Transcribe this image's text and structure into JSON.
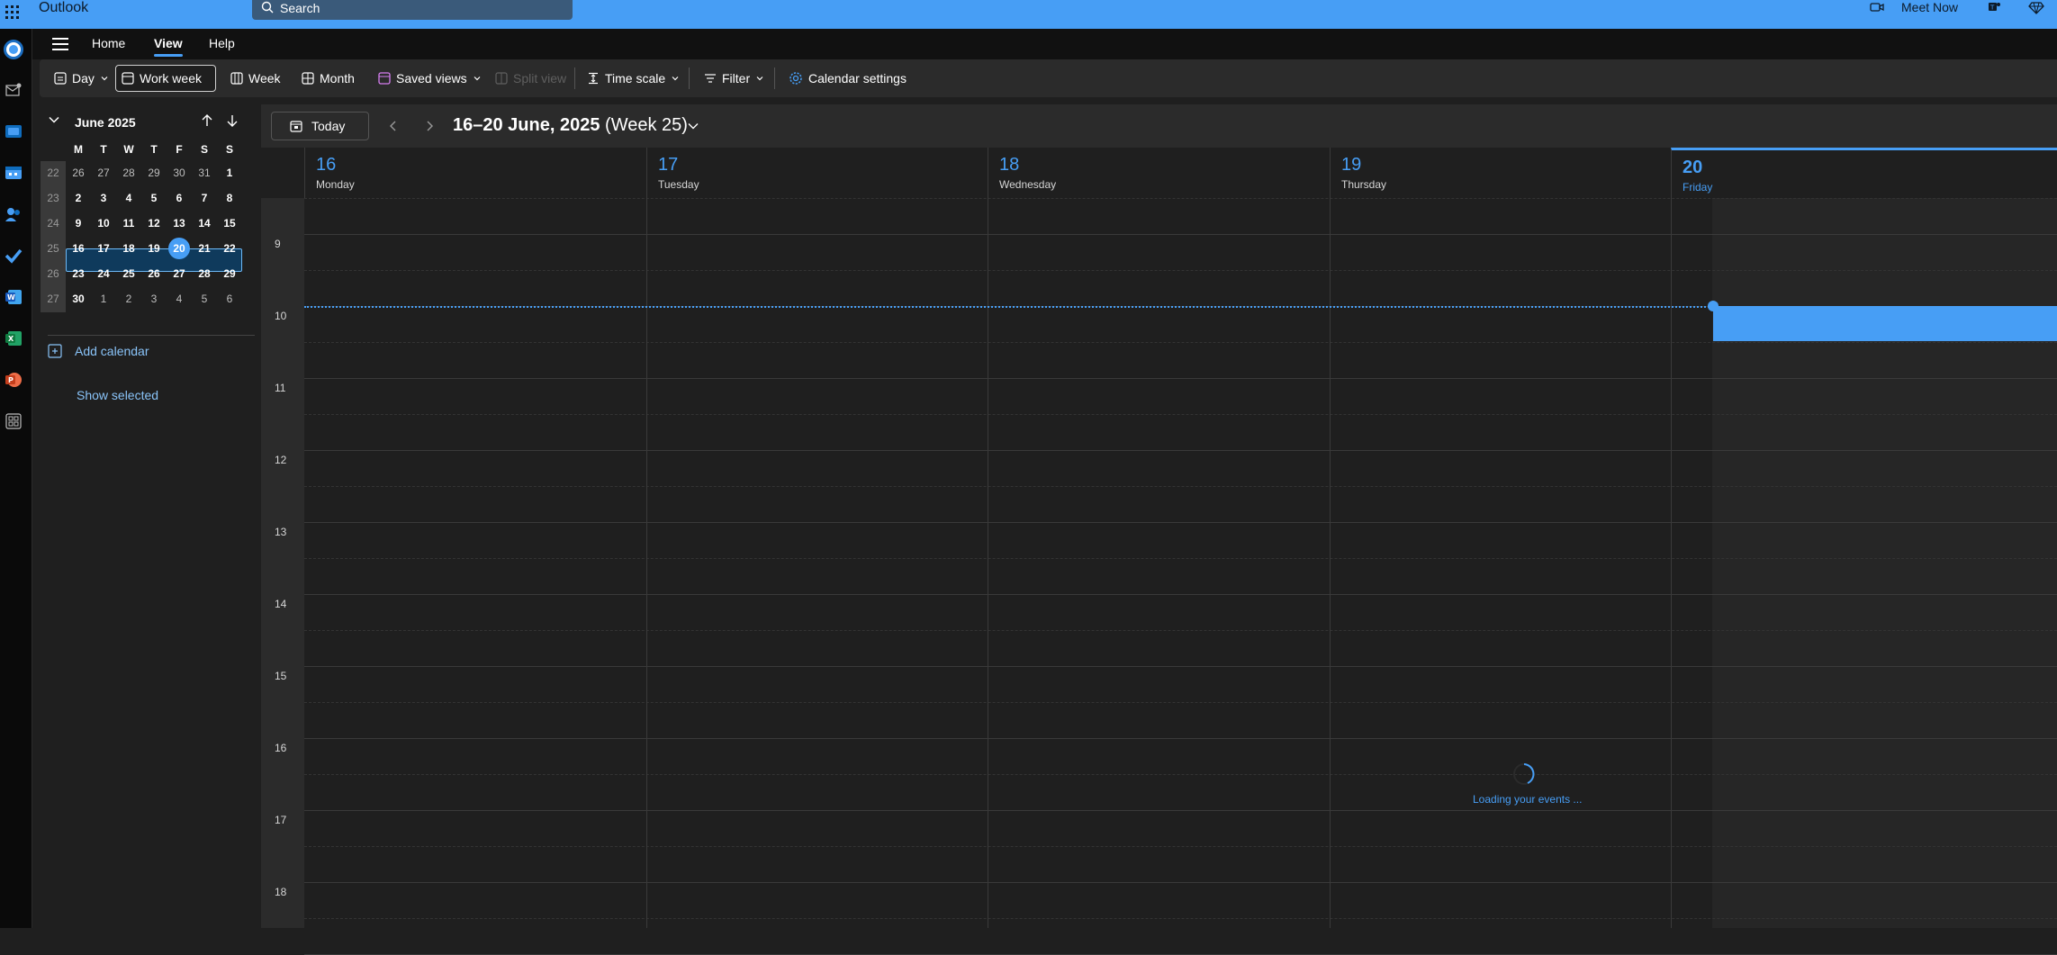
{
  "app": {
    "title": "Outlook",
    "search_placeholder": "Search",
    "meet_now": "Meet Now"
  },
  "tabs": [
    {
      "label": "Home",
      "active": false
    },
    {
      "label": "View",
      "active": true
    },
    {
      "label": "Help",
      "active": false
    }
  ],
  "ribbon": {
    "day": "Day",
    "work_week": "Work week",
    "week": "Week",
    "month": "Month",
    "saved_views": "Saved views",
    "split_view": "Split view",
    "time_scale": "Time scale",
    "filter": "Filter",
    "calendar_settings": "Calendar settings"
  },
  "mini_calendar": {
    "month_label": "June 2025",
    "days_of_week": [
      "M",
      "T",
      "W",
      "T",
      "F",
      "S",
      "S"
    ],
    "weeks": [
      {
        "week": "22",
        "days": [
          "26",
          "27",
          "28",
          "29",
          "30",
          "31",
          "1"
        ]
      },
      {
        "week": "23",
        "days": [
          "2",
          "3",
          "4",
          "5",
          "6",
          "7",
          "8"
        ]
      },
      {
        "week": "24",
        "days": [
          "9",
          "10",
          "11",
          "12",
          "13",
          "14",
          "15"
        ]
      },
      {
        "week": "25",
        "days": [
          "16",
          "17",
          "18",
          "19",
          "20",
          "21",
          "22"
        ]
      },
      {
        "week": "26",
        "days": [
          "23",
          "24",
          "25",
          "26",
          "27",
          "28",
          "29"
        ]
      },
      {
        "week": "27",
        "days": [
          "30",
          "1",
          "2",
          "3",
          "4",
          "5",
          "6"
        ]
      }
    ],
    "today": "20",
    "selected_week": "25"
  },
  "left_panel": {
    "add_calendar": "Add calendar",
    "show_selected": "Show selected"
  },
  "calendar": {
    "today_button": "Today",
    "range_dates": "16–20 June, 2025",
    "range_week": "(Week 25)",
    "days": [
      {
        "num": "16",
        "name": "Monday"
      },
      {
        "num": "17",
        "name": "Tuesday"
      },
      {
        "num": "18",
        "name": "Wednesday"
      },
      {
        "num": "19",
        "name": "Thursday"
      },
      {
        "num": "20",
        "name": "Friday"
      }
    ],
    "hours": [
      "9",
      "10",
      "11",
      "12",
      "13",
      "14",
      "15",
      "16",
      "17",
      "18"
    ],
    "loading_text": "Loading your events ..."
  },
  "colors": {
    "accent": "#479ef5",
    "background": "#1f1f1f",
    "ribbon": "#2b2b2b",
    "rail": "#0a0a0a"
  }
}
